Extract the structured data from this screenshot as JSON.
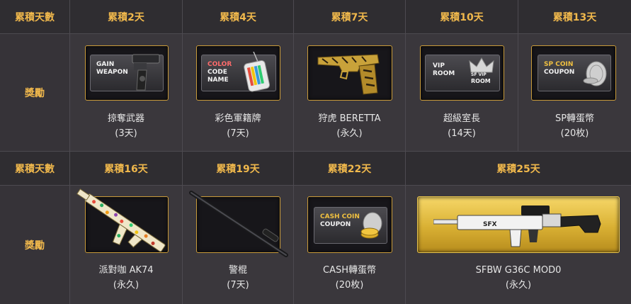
{
  "row1": {
    "header_label": "累積天數",
    "reward_label": "獎勵",
    "items": [
      {
        "day": "累積2天",
        "name": "掠奪武器",
        "duration": "(3天)",
        "card_text": [
          "GAIN",
          "WEAPON"
        ]
      },
      {
        "day": "累積4天",
        "name": "彩色軍籍牌",
        "duration": "(7天)",
        "card_text": [
          "COLOR",
          "CODE",
          "NAME"
        ]
      },
      {
        "day": "累積7天",
        "name": "狩虎 BERETTA",
        "duration": "(永久)"
      },
      {
        "day": "累積10天",
        "name": "超級室長",
        "duration": "(14天)",
        "card_text": [
          "VIP",
          "ROOM",
          "SF VIP",
          "ROOM"
        ]
      },
      {
        "day": "累積13天",
        "name": "SP轉蛋幣",
        "duration": "(20枚)",
        "card_text": [
          "SP COIN",
          "COUPON"
        ]
      }
    ]
  },
  "row2": {
    "header_label": "累積天數",
    "reward_label": "獎勵",
    "items": [
      {
        "day": "累積16天",
        "name": "派對咖 AK74",
        "duration": "(永久)"
      },
      {
        "day": "累積19天",
        "name": "警棍",
        "duration": "(7天)"
      },
      {
        "day": "累積22天",
        "name": "CASH轉蛋幣",
        "duration": "(20枚)",
        "card_text": [
          "CASH COIN",
          "COUPON"
        ]
      },
      {
        "day": "累積25天",
        "name": "SFBW G36C MOD0",
        "duration": "(永久)",
        "card_text": [
          "SFX"
        ]
      }
    ]
  },
  "colors": {
    "accent": "#f0b84c",
    "card_border": "#c89a3a",
    "background": "#3a373c"
  }
}
